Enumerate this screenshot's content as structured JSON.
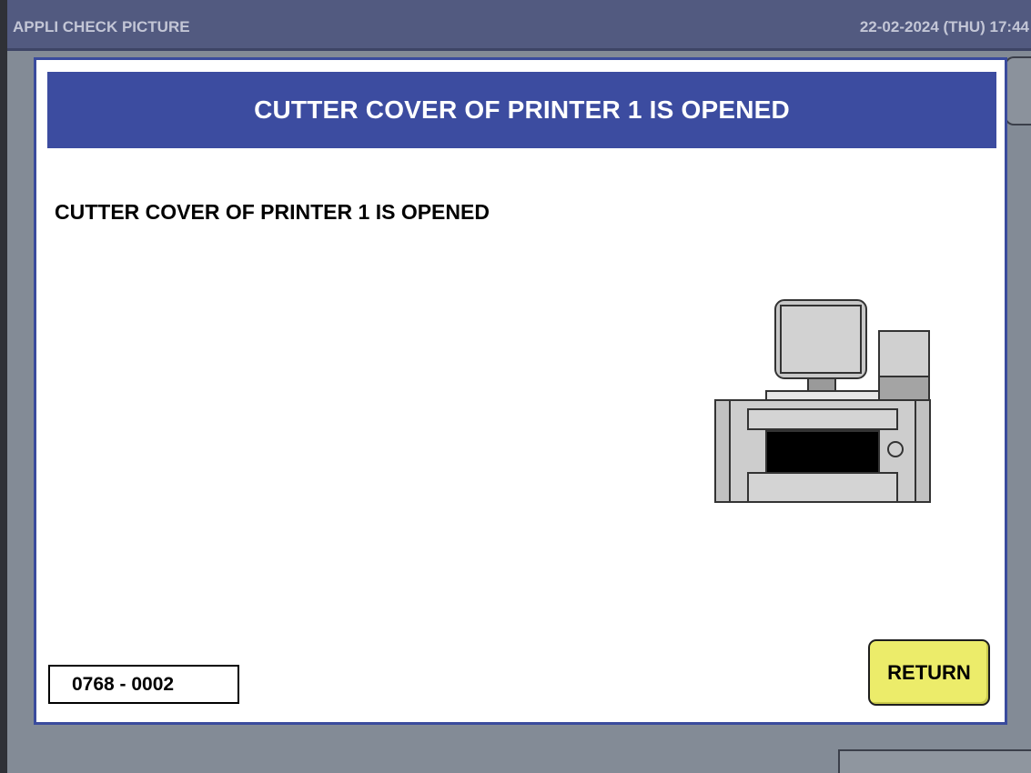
{
  "header": {
    "title": "APPLI CHECK PICTURE",
    "datetime": "22-02-2024 (THU)  17:44"
  },
  "dialog": {
    "title": "CUTTER COVER OF PRINTER 1 IS OPENED",
    "message": "CUTTER COVER OF PRINTER 1 IS OPENED",
    "error_code": "0768 - 0002",
    "return_label": "RETURN",
    "illustration": "printer-scale-icon"
  },
  "colors": {
    "topbar": "#525a80",
    "dialog_header": "#3c4ca0",
    "return_button": "#ecec6a",
    "background": "#838b96"
  }
}
